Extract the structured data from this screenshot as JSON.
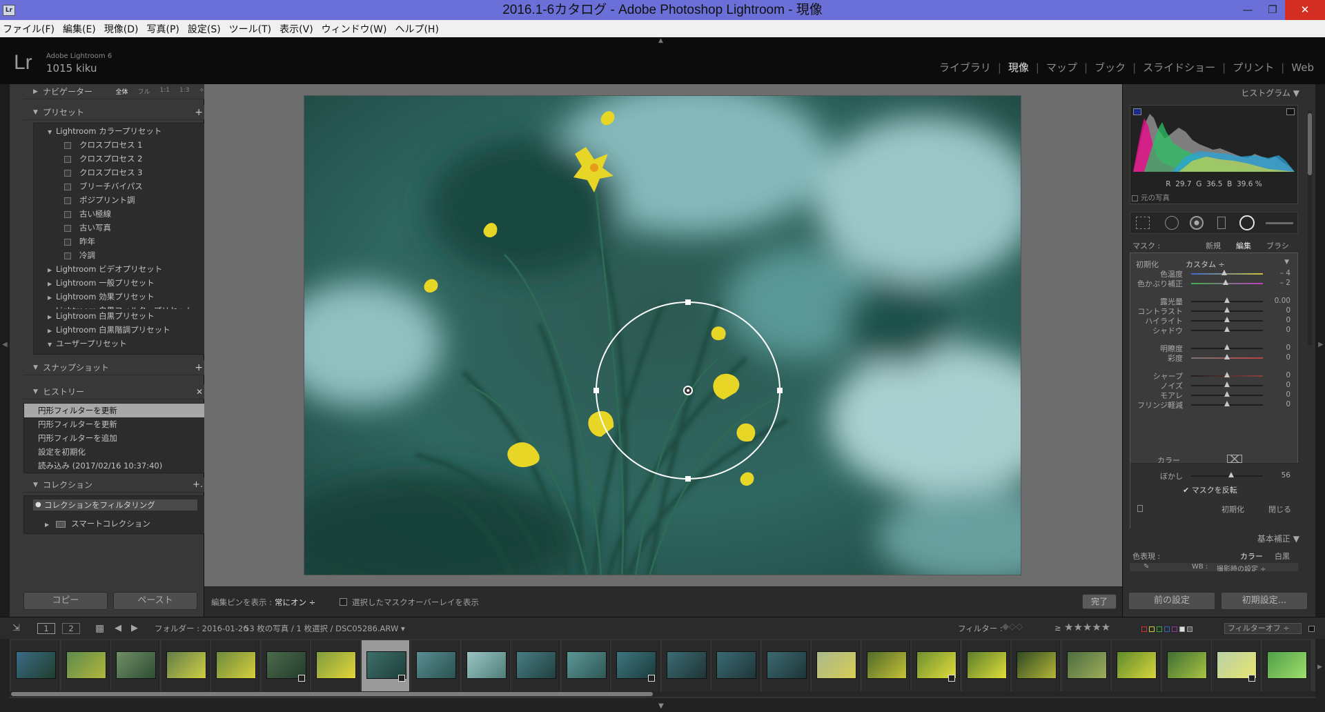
{
  "window": {
    "title": "2016.1-6カタログ - Adobe Photoshop Lightroom - 現像",
    "app_icon": "Lr",
    "minimize": "—",
    "maximize": "❐",
    "close": "✕"
  },
  "menu": [
    "ファイル(F)",
    "編集(E)",
    "現像(D)",
    "写真(P)",
    "設定(S)",
    "ツール(T)",
    "表示(V)",
    "ウィンドウ(W)",
    "ヘルプ(H)"
  ],
  "identity": {
    "logo": "Lr",
    "product": "Adobe Lightroom 6",
    "user": "1015 kiku"
  },
  "modules": [
    {
      "label": "ライブラリ",
      "active": false
    },
    {
      "label": "現像",
      "active": true
    },
    {
      "label": "マップ",
      "active": false
    },
    {
      "label": "ブック",
      "active": false
    },
    {
      "label": "スライドショー",
      "active": false
    },
    {
      "label": "プリント",
      "active": false
    },
    {
      "label": "Web",
      "active": false
    }
  ],
  "left": {
    "navigator": {
      "label": "ナビゲーター",
      "options": [
        "全体",
        "フル",
        "1:1",
        "1:3"
      ],
      "options_caret": "÷"
    },
    "presets": {
      "label": "プリセット",
      "add": "+",
      "groups": [
        {
          "label": "Lightroom カラープリセット",
          "open": true,
          "items": [
            "クロスプロセス 1",
            "クロスプロセス 2",
            "クロスプロセス 3",
            "ブリーチバイパス",
            "ポジプリント調",
            "古い極線",
            "古い写真",
            "昨年",
            "冷調"
          ]
        },
        {
          "label": "Lightroom ビデオプリセット",
          "open": false
        },
        {
          "label": "Lightroom 一般プリセット",
          "open": false
        },
        {
          "label": "Lightroom 効果プリセット",
          "open": false
        },
        {
          "label": "Lightroom 白黒フィルタープリセット",
          "open": false
        },
        {
          "label": "Lightroom 白黒プリセット",
          "open": false
        },
        {
          "label": "Lightroom 白黒階調プリセット",
          "open": false
        },
        {
          "label": "ユーザープリセット",
          "open": true
        }
      ]
    },
    "snapshot": {
      "label": "スナップショット",
      "add": "+"
    },
    "history": {
      "label": "ヒストリー",
      "clear": "✕",
      "items": [
        "円形フィルターを更新",
        "円形フィルターを更新",
        "円形フィルターを追加",
        "設定を初期化",
        "読み込み (2017/02/16 10:37:40)"
      ]
    },
    "collections": {
      "label": "コレクション",
      "add": "+.",
      "filter": "コレクションをフィルタリング",
      "smart": "スマートコレクション"
    },
    "copy": "コピー",
    "paste": "ペースト"
  },
  "toolbar": {
    "pin_label": "編集ピンを表示 :",
    "pin_value": "常にオン ÷",
    "overlay_label": "選択したマスクオーバーレイを表示",
    "done": "完了"
  },
  "right": {
    "histogram": {
      "label": "ヒストグラム",
      "r_label": "R",
      "r": "29.7",
      "g_label": "G",
      "g": "36.5",
      "b_label": "B",
      "b": "39.6 %",
      "original": "元の写真"
    },
    "mask": {
      "label": "マスク :",
      "new": "新規",
      "edit": "編集",
      "brush": "ブラシ"
    },
    "effect": {
      "label": "初期化",
      "value": "カスタム ÷"
    },
    "sliders": [
      {
        "label": "色温度",
        "value": "– 4",
        "pos": 0.46
      },
      {
        "label": "色かぶり補正",
        "value": "– 2",
        "pos": 0.48
      },
      {
        "label": "露光量",
        "value": "0.00",
        "pos": 0.5
      },
      {
        "label": "コントラスト",
        "value": "0",
        "pos": 0.5
      },
      {
        "label": "ハイライト",
        "value": "0",
        "pos": 0.5
      },
      {
        "label": "シャドウ",
        "value": "0",
        "pos": 0.5
      },
      {
        "label": "明瞭度",
        "value": "0",
        "pos": 0.5
      },
      {
        "label": "彩度",
        "value": "0",
        "pos": 0.5
      },
      {
        "label": "シャープ",
        "value": "0",
        "pos": 0.5
      },
      {
        "label": "ノイズ",
        "value": "0",
        "pos": 0.5
      },
      {
        "label": "モアレ",
        "value": "0",
        "pos": 0.5
      },
      {
        "label": "フリンジ軽減",
        "value": "0",
        "pos": 0.5
      }
    ],
    "color_label": "カラー",
    "feather": {
      "label": "ぼかし",
      "value": "56",
      "pos": 0.56
    },
    "invert": "マスクを反転",
    "reset": "初期化",
    "close": "閉じる",
    "basic": "基本補正",
    "treatment_label": "色表現 :",
    "treatment_color": "カラー",
    "treatment_bw": "白黒",
    "wb_partial": "WB :",
    "wb_value": "撮影時の設定 ÷",
    "prev": "前の設定",
    "reset_btn": "初期設定..."
  },
  "filmbar": {
    "page1": "1",
    "page2": "2",
    "folder": "フォルダー : 2016-01-26",
    "count": "53 枚の写真 / 1 枚選択 / DSC05286.ARW ▾",
    "filter_label": "フィルター :",
    "ge": "≥",
    "stars": "★★★★★",
    "filter_value": "フィルターオフ ÷"
  },
  "thumbnails": [
    {
      "colors": [
        "#3a6a86",
        "#1f3f2c"
      ],
      "badge": false
    },
    {
      "colors": [
        "#5d8a4e",
        "#b0b73a"
      ],
      "badge": false
    },
    {
      "colors": [
        "#6f8f66",
        "#2f4d33"
      ],
      "badge": false
    },
    {
      "colors": [
        "#627d48",
        "#cfcf44"
      ],
      "badge": false
    },
    {
      "colors": [
        "#6c8b3e",
        "#d6cf3b"
      ],
      "badge": false
    },
    {
      "colors": [
        "#4a6b4c",
        "#243a2a"
      ],
      "badge": true
    },
    {
      "colors": [
        "#7f9b3d",
        "#e3d63a"
      ],
      "badge": false
    },
    {
      "colors": [
        "#3f6f6a",
        "#1e3e3a"
      ],
      "badge": true,
      "selected": true
    },
    {
      "colors": [
        "#5a8e93",
        "#2a514f"
      ],
      "badge": false
    },
    {
      "colors": [
        "#9ac4c4",
        "#4f7f79"
      ],
      "badge": false
    },
    {
      "colors": [
        "#477e84",
        "#22403f"
      ],
      "badge": false
    },
    {
      "colors": [
        "#5c9896",
        "#2e5755"
      ],
      "badge": false
    },
    {
      "colors": [
        "#3f767f",
        "#1b3a3c"
      ],
      "badge": true
    },
    {
      "colors": [
        "#3c6c74",
        "#1e3436"
      ],
      "badge": false
    },
    {
      "colors": [
        "#3a6a73",
        "#1e3638"
      ],
      "badge": false
    },
    {
      "colors": [
        "#3b6a71",
        "#1d3537"
      ],
      "badge": false
    },
    {
      "colors": [
        "#a9b98a",
        "#d7cc55"
      ],
      "badge": false
    },
    {
      "colors": [
        "#4f6a2a",
        "#c6c236"
      ],
      "badge": false
    },
    {
      "colors": [
        "#6e8f2f",
        "#e2dc3a"
      ],
      "badge": true
    },
    {
      "colors": [
        "#5b7d2c",
        "#e0dd3a"
      ],
      "badge": false
    },
    {
      "colors": [
        "#2f4a24",
        "#b5b538"
      ],
      "badge": false
    },
    {
      "colors": [
        "#4d6c40",
        "#9dad5a"
      ],
      "badge": false
    },
    {
      "colors": [
        "#5f8a2c",
        "#d8d63b"
      ],
      "badge": false
    },
    {
      "colors": [
        "#3e6e34",
        "#a9c342"
      ],
      "badge": false
    },
    {
      "colors": [
        "#b7d1a8",
        "#e8e46e"
      ],
      "badge": true
    },
    {
      "colors": [
        "#4fa04a",
        "#9fde6a"
      ],
      "badge": false
    }
  ]
}
